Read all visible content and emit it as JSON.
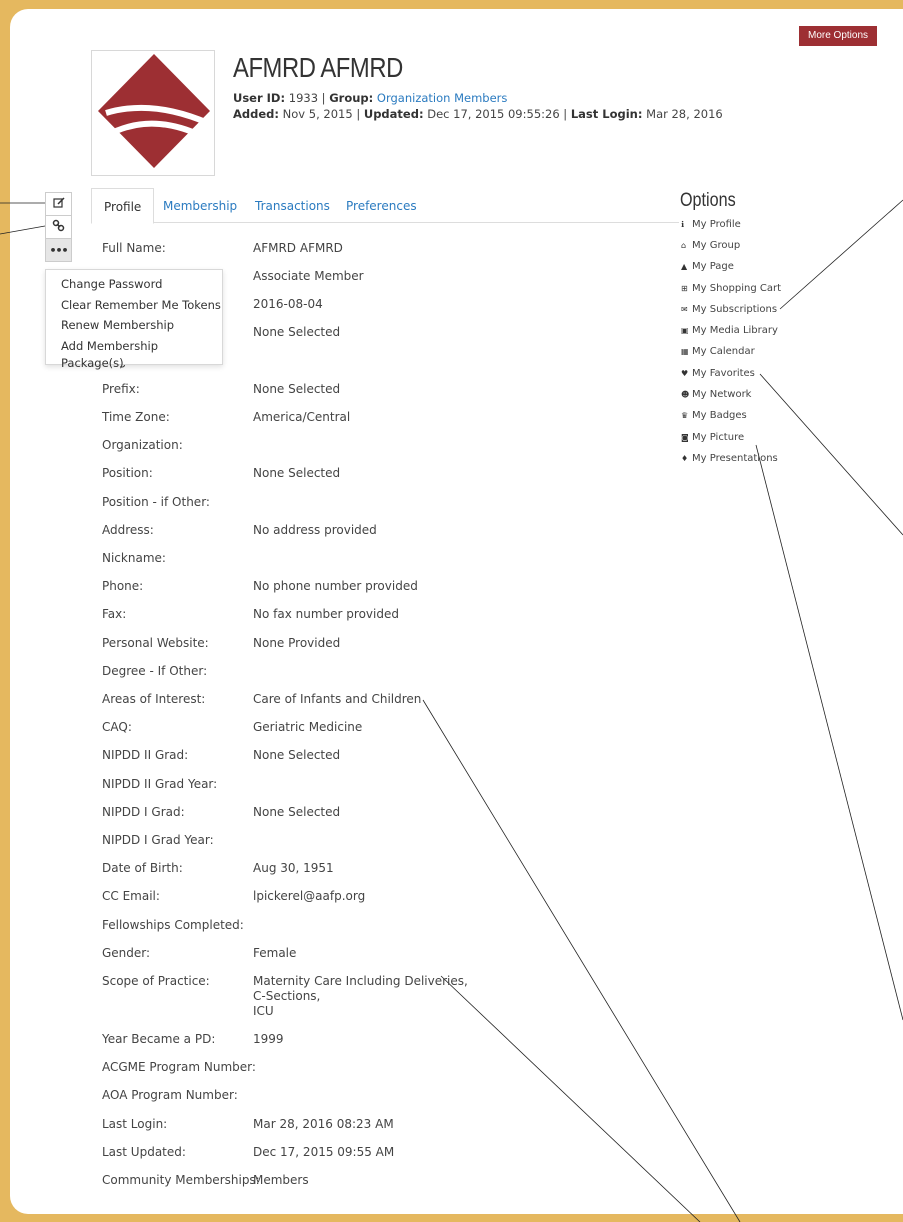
{
  "header": {
    "more_options": "More Options",
    "name": "AFMRD AFMRD",
    "user_id_label": "User ID",
    "user_id": "1933",
    "group_label": "Group",
    "group": "Organization Members",
    "added_label": "Added",
    "added": "Nov 5, 2015",
    "updated_label": "Updated",
    "updated": "Dec 17, 2015 09:55:26",
    "last_login_label": "Last Login",
    "last_login": "Mar 28, 2016"
  },
  "toolbar": {
    "edit_icon": "edit-icon",
    "link_icon": "link-icon",
    "more_icon": "ellipsis-icon"
  },
  "dropdown": {
    "items": [
      "Change Password",
      "Clear Remember Me Tokens",
      "Renew Membership",
      "Add Membership Package(s)"
    ]
  },
  "tabs": [
    "Profile",
    "Membership",
    "Transactions",
    "Preferences"
  ],
  "profile": {
    "rows": [
      {
        "label": "Full Name:",
        "value": "AFMRD AFMRD"
      },
      {
        "label": "",
        "value": "Associate Member"
      },
      {
        "label": "",
        "value": "2016-08-04"
      },
      {
        "label": "",
        "value": "None Selected"
      },
      {
        "label": "Degree - If Other:",
        "value": ""
      },
      {
        "label": "Prefix:",
        "value": "None Selected"
      },
      {
        "label": "Time Zone:",
        "value": "America/Central"
      },
      {
        "label": "Organization:",
        "value": ""
      },
      {
        "label": "Position:",
        "value": "None Selected"
      },
      {
        "label": "Position - if Other:",
        "value": ""
      },
      {
        "label": "Address:",
        "value": "No address provided"
      },
      {
        "label": "Nickname:",
        "value": ""
      },
      {
        "label": "Phone:",
        "value": "No phone number provided"
      },
      {
        "label": "Fax:",
        "value": "No fax number provided"
      },
      {
        "label": "Personal Website:",
        "value": "None Provided"
      },
      {
        "label": "Degree - If Other:",
        "value": ""
      },
      {
        "label": "Areas of Interest:",
        "value": "Care of Infants and Children"
      },
      {
        "label": "CAQ:",
        "value": "Geriatric Medicine"
      },
      {
        "label": "NIPDD II Grad:",
        "value": "None Selected"
      },
      {
        "label": "NIPDD II Grad Year:",
        "value": ""
      },
      {
        "label": "NIPDD I Grad:",
        "value": "None Selected"
      },
      {
        "label": "NIPDD I Grad Year:",
        "value": ""
      },
      {
        "label": "Date of Birth:",
        "value": "Aug 30, 1951"
      },
      {
        "label": "CC Email:",
        "value": "lpickerel@aafp.org"
      },
      {
        "label": "Fellowships Completed:",
        "value": ""
      },
      {
        "label": "Gender:",
        "value": "Female"
      },
      {
        "label": "Scope of Practice:",
        "value": "Maternity Care Including Deliveries,\nC-Sections,\nICU"
      },
      {
        "label": "Year Became a PD:",
        "value": "1999"
      },
      {
        "label": "ACGME Program Number:",
        "value": ""
      },
      {
        "label": "AOA Program Number:",
        "value": ""
      },
      {
        "label": "Last Login:",
        "value": "Mar 28, 2016 08:23 AM"
      },
      {
        "label": "Last Updated:",
        "value": "Dec 17, 2015 09:55 AM"
      },
      {
        "label": "Community Memberships:",
        "value": "Members"
      }
    ]
  },
  "options": {
    "title": "Options",
    "items": [
      {
        "label": "My Profile",
        "icon": "info-icon"
      },
      {
        "label": "My Group",
        "icon": "home-icon"
      },
      {
        "label": "My Page",
        "icon": "user-icon"
      },
      {
        "label": "My Shopping Cart",
        "icon": "cart-icon"
      },
      {
        "label": "My Subscriptions",
        "icon": "envelope-icon"
      },
      {
        "label": "My Media Library",
        "icon": "image-icon"
      },
      {
        "label": "My Calendar",
        "icon": "calendar-icon"
      },
      {
        "label": "My Favorites",
        "icon": "heart-icon"
      },
      {
        "label": "My Network",
        "icon": "users-icon"
      },
      {
        "label": "My Badges",
        "icon": "trophy-icon"
      },
      {
        "label": "My Picture",
        "icon": "camera-icon"
      },
      {
        "label": "My Presentations",
        "icon": "microphone-icon"
      }
    ]
  },
  "colors": {
    "frame": "#e5b85f",
    "accent": "#9d2f33",
    "link": "#2b7bc0"
  }
}
